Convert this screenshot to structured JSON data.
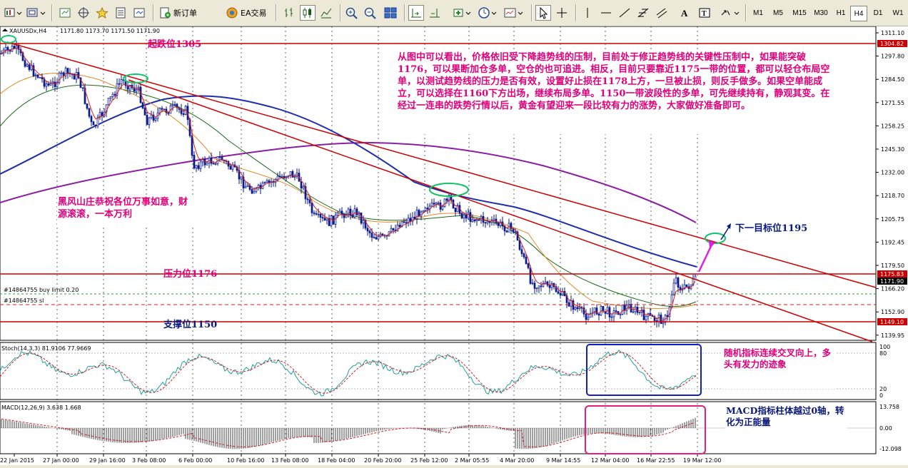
{
  "toolbar": {
    "new_order_label": "新订单",
    "ea_label": "EA交易",
    "timeframes": [
      "M1",
      "M5",
      "M15",
      "M30",
      "H1",
      "H4",
      "D1",
      "W1"
    ],
    "active_timeframe": "H4"
  },
  "chart_header": {
    "symbol": "XAUUSDx,H4",
    "ohlc": "1171.80 1173.70 1171.50 1171.90"
  },
  "price_axis": {
    "ticks": [
      "1311.10",
      "1297.80",
      "1284.50",
      "1271.55",
      "1258.25",
      "1245.30",
      "1232.00",
      "1218.70",
      "1205.75",
      "1192.45",
      "1179.50",
      "1166.20",
      "1152.90",
      "1139.95"
    ],
    "tags": [
      {
        "label": "1304.82",
        "color": "#cc0000",
        "text_color": "#ffffff"
      },
      {
        "label": "1175.83",
        "color": "#cc0000",
        "text_color": "#ffffff"
      },
      {
        "label": "1171.90",
        "color": "#000000",
        "text_color": "#ffffff"
      },
      {
        "label": "1149.10",
        "color": "#cc0000",
        "text_color": "#ffffff"
      }
    ]
  },
  "time_axis": {
    "ticks": [
      "22 Jan 2015",
      "27 Jan 00:00",
      "29 Jan 16:00",
      "3 Feb 08:00",
      "6 Feb 00:00",
      "10 Feb 16:00",
      "13 Feb 08:00",
      "18 Feb 04:00",
      "20 Feb 20:00",
      "25 Feb 12:00",
      "2 Mar 05:55",
      "4 Mar 20:00",
      "9 Mar 14:55",
      "12 Mar 04:00",
      "16 Mar 22:55",
      "19 Mar 12:00"
    ]
  },
  "annotations": {
    "start_level": "起跌位1305",
    "resistance": "压力位1176",
    "support": "支撑位1150",
    "next_target": "下一目标位1195",
    "greeting": "黑风山庄恭祝各位万事如意，财源滚滚，一本万利",
    "analysis": "从图中可以看出，价格依旧受下降趋势线的压制，目前处于修正趋势线的关键性压制中，如果能突破1176，可以果断加仓多单，空仓的也可追进。相反，目前只要靠近1175一带的位置，都可以轻仓布局空单，以测试趋势线的压力是否有效，设置好止损在1178上方，一旦被止损，则反手做多。如果空单能成立，可以选择在1160下方出场，继续布局多单。1150一带波段性的多单，可先继续持有，静观其变。在经过一连串的跌势行情以后，黄金有望迎来一段比较有力的涨势，大家做好准备即可。",
    "stoch_note": "随机指标连续交叉向上，多头有发力的迹象",
    "macd_note": "MACD指标柱体越过0轴，转化为正能量"
  },
  "orders": {
    "buy_limit": "#14864755 buy limit 0.20",
    "sl": "#14864755 sl"
  },
  "stochastic": {
    "label": "Stoch(14,3,3) 81.9106 77.9669",
    "ticks": [
      "100",
      "80",
      "20",
      "0"
    ]
  },
  "macd": {
    "label": "MACD(12,26,9) 3.638 1.668",
    "ticks": [
      "13.758",
      "0.00",
      "-12.098"
    ]
  },
  "colors": {
    "level_line": "#cc0000",
    "trend_line": "#cc0000",
    "ma_blue": "#1f2fa8",
    "ma_purple": "#8a1fa0",
    "annotation_text": "#e0007a",
    "label_navy": "#0a1a7a",
    "highlight_green": "#12c46a"
  }
}
